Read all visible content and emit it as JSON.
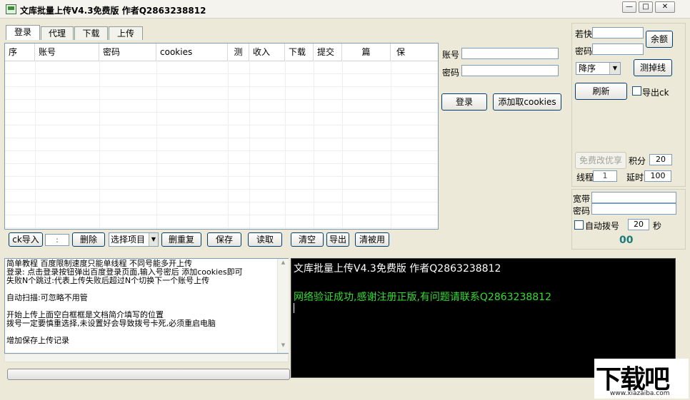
{
  "window": {
    "title": "文库批量上传V4.3免费版 作者Q2863238812"
  },
  "tabs": [
    "登录",
    "代理",
    "下载",
    "上传"
  ],
  "table": {
    "columns": [
      "序",
      "账号",
      "密码",
      "cookies",
      "测",
      "收入",
      "下载",
      "提交",
      "篇",
      "保"
    ]
  },
  "login_panel": {
    "account_label": "账号",
    "account_value": "",
    "password_label": "密码",
    "password_value": "",
    "login_button": "登录",
    "add_cookie_button": "添加取cookies"
  },
  "right_panel": {
    "ruokuai_label": "若快",
    "ruokuai_value": "",
    "password_label": "密码",
    "password_value": "",
    "balance_button": "余额",
    "sort_value": "降序",
    "test_drop_button": "测掉线",
    "refresh_button": "刷新",
    "export_ck_label": "导出ck",
    "free_share_button": "免费改优享",
    "points_label": "积分",
    "points_value": "20",
    "threads_label": "线程",
    "threads_value": "1",
    "delay_label": "延时",
    "delay_value": "100",
    "broadband_label": "宽带",
    "broadband_value": "",
    "bb_password_label": "密码",
    "bb_password_value": "",
    "auto_dial_label": "自动拨号",
    "auto_dial_value": "20",
    "seconds_label": "秒",
    "counter": "00"
  },
  "toolbar": {
    "ck_import": "ck导入",
    "small_input": ":",
    "delete": "删除",
    "select_items": "选择项目",
    "delete_dup": "删重复",
    "save": "保存",
    "read": "读取",
    "clear": "清空",
    "export": "导出",
    "clear_used": "清被用"
  },
  "notes": [
    "简单教程 百度限制速度只能单线程 不同号能多开上传",
    "登录: 点击登录按钮弹出百度登录页面,输入号密后 添加cookies即可",
    "失败N个跳过:代表上传失败后超过N个切换下一个账号上传",
    "",
    "自动扫描:可忽略不用管",
    "",
    "开始上传上面空白框框是文档简介填写的位置",
    "拨号一定要慎重选择,未设置好会导致拨号卡死,必须重启电脑",
    "",
    "增加保存上传记录"
  ],
  "console": {
    "line1": "文库批量上传V4.3免费版 作者Q2863238812",
    "line2": "网络验证成功,感谢注册正版,有问题请联系Q2863238812"
  },
  "watermark": {
    "text": "下载吧",
    "url": "www.xiazaiba.com"
  },
  "colors": {
    "console_bg": "#000000",
    "console_white": "#ffffff",
    "console_green": "#33dd33",
    "counter": "#1a7a7a"
  }
}
